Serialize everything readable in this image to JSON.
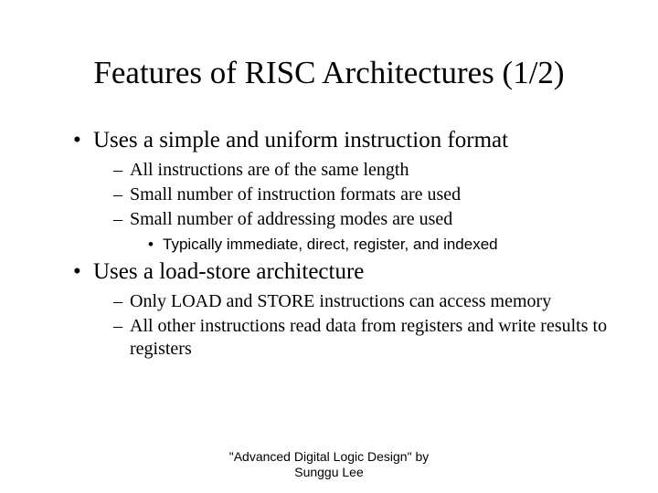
{
  "title": "Features of RISC Architectures (1/2)",
  "bullets": {
    "b1": {
      "text": "Uses a simple and uniform instruction format",
      "sub": {
        "s1": "All instructions are of the same length",
        "s2": "Small number of instruction formats are used",
        "s3": "Small number of addressing modes are used",
        "s3sub": {
          "t1": "Typically immediate, direct, register, and indexed"
        }
      }
    },
    "b2": {
      "text": "Uses a load-store architecture",
      "sub": {
        "s1": "Only LOAD and STORE instructions can access memory",
        "s2": "All other instructions read data from registers and write results to registers"
      }
    }
  },
  "footer": {
    "line1": "\"Advanced Digital Logic Design\" by",
    "line2": "Sunggu Lee"
  }
}
